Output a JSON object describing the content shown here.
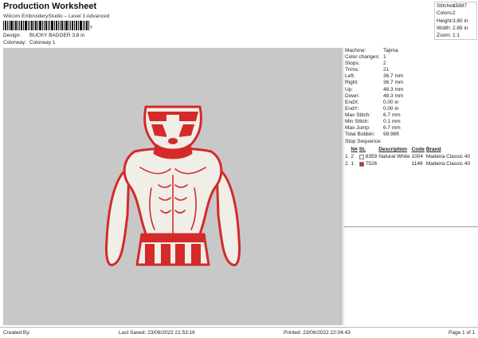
{
  "header": {
    "title": "Production Worksheet",
    "subtitle": "Wilcom EmbroideryStudio – Level 3 Advanced",
    "barcode_suffix": ","
  },
  "design_info": {
    "design_label": "Design:",
    "design_value": "BUCKY BADGER 3,8 in",
    "colorway_label": "Colorway:",
    "colorway_value": "Colorway 1"
  },
  "summary": [
    {
      "label": "Stitches:",
      "value": "15887"
    },
    {
      "label": "Colors:",
      "value": "2"
    },
    {
      "label": "Height:",
      "value": "3.80 in"
    },
    {
      "label": "Width:",
      "value": "2.89 in"
    },
    {
      "label": "Zoom:",
      "value": "1:1"
    }
  ],
  "machine_info": [
    {
      "label": "Machine:",
      "value": "Tajima"
    },
    {
      "label": "Color changes:",
      "value": "1"
    },
    {
      "label": "Stops:",
      "value": "2"
    },
    {
      "label": "Trims:",
      "value": "21"
    },
    {
      "label": "Left:",
      "value": "36.7 mm"
    },
    {
      "label": "Right:",
      "value": "36.7 mm"
    },
    {
      "label": "Up:",
      "value": "48.3 mm"
    },
    {
      "label": "Down:",
      "value": "48.3 mm"
    },
    {
      "label": "EndX:",
      "value": "0.00 in"
    },
    {
      "label": "EndY:",
      "value": "0.00 in"
    },
    {
      "label": "Max Stitch:",
      "value": "6.7 mm"
    },
    {
      "label": "Min Stitch:",
      "value": "0.1 mm"
    },
    {
      "label": "Max Jump:",
      "value": "6.7 mm"
    },
    {
      "label": "Total Bobbin:",
      "value": "99.96ft"
    }
  ],
  "stop_sequence": {
    "title": "Stop Sequence:",
    "headers": [
      "",
      "N#",
      "St.",
      "Description",
      "Code",
      "Brand"
    ],
    "rows": [
      {
        "stop": "1.",
        "needle": "2",
        "color": "#efefe8",
        "st": "8359",
        "description": "Natural White",
        "code": "1004",
        "brand": "Madeira Classic 40"
      },
      {
        "stop": "2.",
        "needle": "1",
        "color": "#d42a2a",
        "st": "7526",
        "description": "",
        "code": "1146",
        "brand": "Madeira Classic 40"
      }
    ]
  },
  "footer": {
    "created_by": "Created By:",
    "last_saved": "Last Saved: 23/06/2022 21:53:16",
    "printed": "Printed: 23/06/2022 22:04:43",
    "page": "Page 1 of 1"
  },
  "colors": {
    "thread_red": "#d42a2a",
    "thread_white": "#efefe8",
    "canvas_bg": "#c8c8c8"
  }
}
